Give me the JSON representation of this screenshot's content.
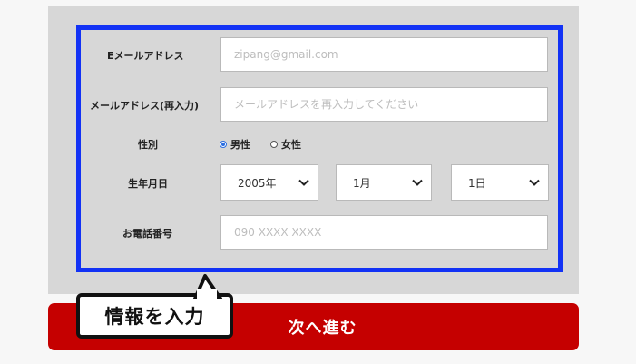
{
  "form": {
    "email_label": "Eメールアドレス",
    "email_placeholder": "zipang@gmail.com",
    "email_confirm_label": "メールアドレス(再入力)",
    "email_confirm_placeholder": "メールアドレスを再入力してください",
    "gender_label": "性別",
    "gender_options": [
      {
        "label": "男性",
        "checked": true
      },
      {
        "label": "女性",
        "checked": false
      }
    ],
    "birthdate_label": "生年月日",
    "birth_year": "2005年",
    "birth_month": "1月",
    "birth_day": "1日",
    "phone_label": "お電話番号",
    "phone_placeholder": "090 XXXX XXXX"
  },
  "next_button_label": "次へ進む",
  "callout_text": "情報を入力",
  "colors": {
    "frame": "#1232f5",
    "button": "#c50000",
    "panel": "#d7d7d7",
    "radio_accent": "#2a6de0"
  }
}
